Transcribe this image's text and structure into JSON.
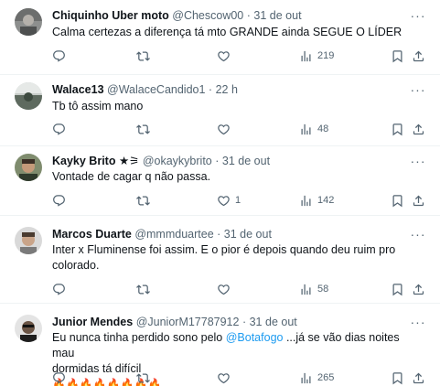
{
  "tweets": [
    {
      "name": "Chiquinho Uber moto",
      "handle": "@Chescow00",
      "time": "31 de out",
      "text": "Calma certezas a diferença tá mto GRANDE ainda SEGUE O LÍDER",
      "replies": "",
      "retweets": "",
      "likes": "",
      "views": "219"
    },
    {
      "name": "Walace13",
      "handle": "@WalaceCandido1",
      "time": "22 h",
      "text": "Tb tô assim mano",
      "replies": "",
      "retweets": "",
      "likes": "",
      "views": "48"
    },
    {
      "name": "Kayky Brito ★⚞",
      "handle": "@okaykybrito",
      "time": "31 de out",
      "text": "Vontade de cagar q não passa.",
      "replies": "",
      "retweets": "",
      "likes": "1",
      "views": "142"
    },
    {
      "name": "Marcos Duarte",
      "handle": "@mmmduartee",
      "time": "31 de out",
      "text_line1": "Inter x Fluminense foi assim. E o pior é depois quando deu ruim pro",
      "text_line2": "colorado.",
      "replies": "",
      "retweets": "",
      "likes": "",
      "views": "58"
    },
    {
      "name": "Junior Mendes",
      "handle": "@JuniorM17787912",
      "time": "31 de out",
      "text_prefix": "Eu nunca tinha perdido sono pelo ",
      "mention": "@Botafogo",
      "text_suffix": " ...já se vão dias noites mau",
      "text_line2": "dormidas tá difícil",
      "emoji": "🔥🔥🔥🔥🔥🔥🔥🔥",
      "replies": "",
      "retweets": "",
      "likes": "",
      "views": "265"
    }
  ],
  "separator": "·",
  "more_glyph": "···",
  "icons": [
    "reply-icon",
    "retweet-icon",
    "like-icon",
    "views-icon",
    "bookmark-icon",
    "share-icon",
    "more-options-icon"
  ],
  "colors": {
    "text": "#0f1419",
    "secondary": "#536471",
    "link": "#1d9bf0",
    "divider": "#eff3f4"
  }
}
